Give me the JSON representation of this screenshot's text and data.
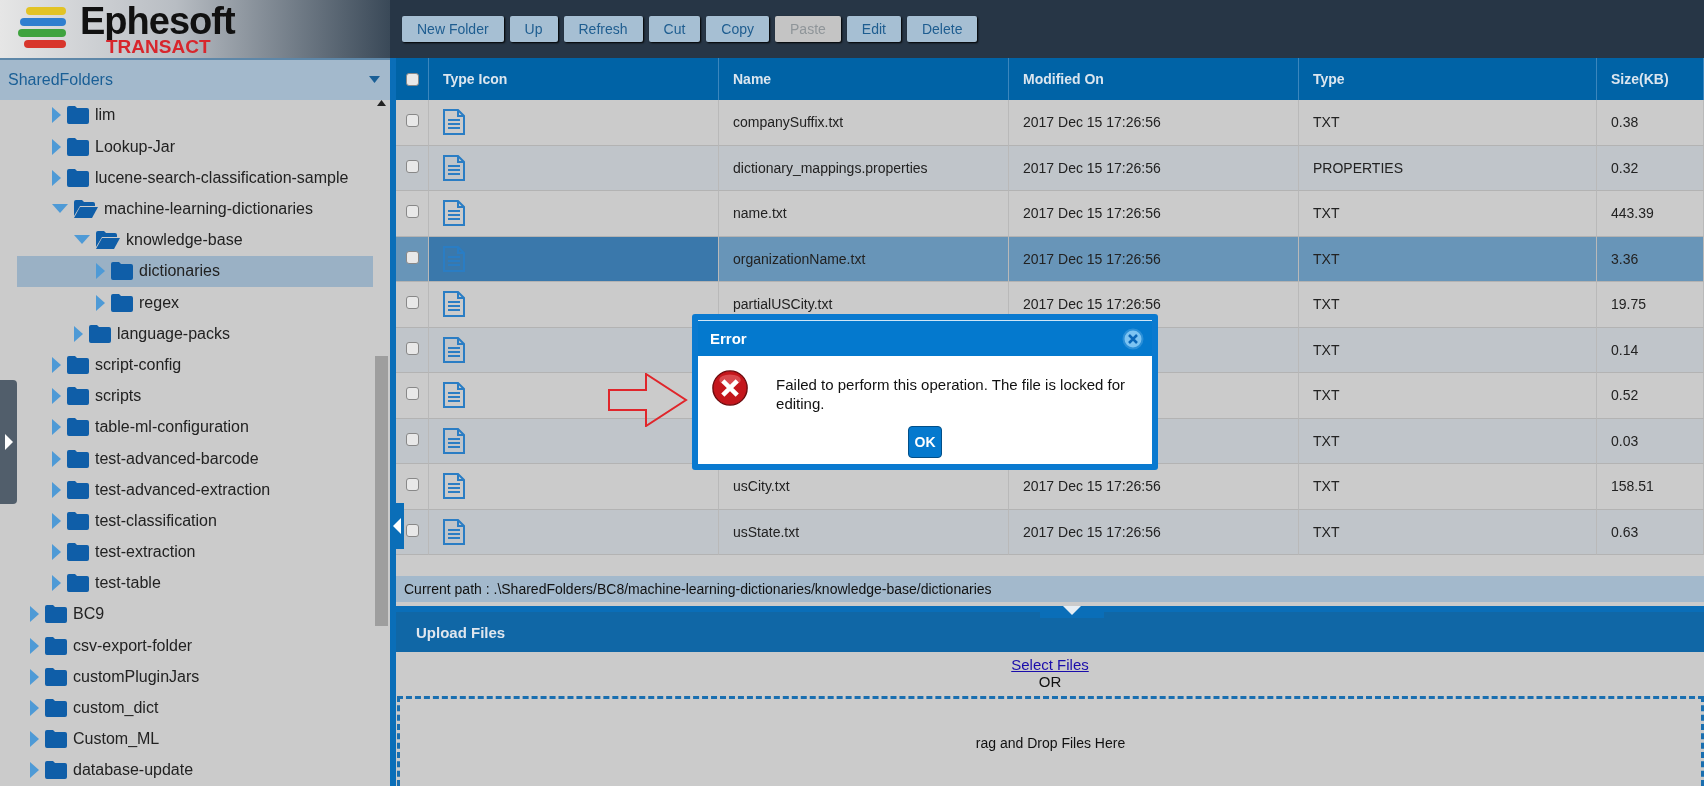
{
  "logo": {
    "name": "Ephesoft",
    "product": "TRANSACT"
  },
  "toolbar": [
    {
      "label": "New Folder",
      "disabled": false
    },
    {
      "label": "Up",
      "disabled": false
    },
    {
      "label": "Refresh",
      "disabled": false
    },
    {
      "label": "Cut",
      "disabled": false
    },
    {
      "label": "Copy",
      "disabled": false
    },
    {
      "label": "Paste",
      "disabled": true
    },
    {
      "label": "Edit",
      "disabled": false
    },
    {
      "label": "Delete",
      "disabled": false
    }
  ],
  "sidebar": {
    "root": "SharedFolders",
    "tree": [
      {
        "children": [
          {
            "label": "lim",
            "expanded": false,
            "selected": false
          },
          {
            "label": "Lookup-Jar",
            "expanded": false,
            "selected": false
          },
          {
            "label": "lucene-search-classification-sample",
            "expanded": false,
            "selected": false
          },
          {
            "label": "machine-learning-dictionaries",
            "expanded": true,
            "selected": false,
            "children": [
              {
                "label": "knowledge-base",
                "expanded": true,
                "selected": false,
                "children": [
                  {
                    "label": "dictionaries",
                    "expanded": false,
                    "selected": true
                  },
                  {
                    "label": "regex",
                    "expanded": false,
                    "selected": false
                  }
                ]
              },
              {
                "label": "language-packs",
                "expanded": false,
                "selected": false
              }
            ]
          },
          {
            "label": "script-config",
            "expanded": false,
            "selected": false
          },
          {
            "label": "scripts",
            "expanded": false,
            "selected": false
          },
          {
            "label": "table-ml-configuration",
            "expanded": false,
            "selected": false
          },
          {
            "label": "test-advanced-barcode",
            "expanded": false,
            "selected": false
          },
          {
            "label": "test-advanced-extraction",
            "expanded": false,
            "selected": false
          },
          {
            "label": "test-classification",
            "expanded": false,
            "selected": false
          },
          {
            "label": "test-extraction",
            "expanded": false,
            "selected": false
          },
          {
            "label": "test-table",
            "expanded": false,
            "selected": false
          }
        ]
      },
      {
        "label": "BC9",
        "expanded": false,
        "selected": false
      },
      {
        "label": "csv-export-folder",
        "expanded": false,
        "selected": false
      },
      {
        "label": "customPluginJars",
        "expanded": false,
        "selected": false
      },
      {
        "label": "custom_dict",
        "expanded": false,
        "selected": false
      },
      {
        "label": "Custom_ML",
        "expanded": false,
        "selected": false
      },
      {
        "label": "database-update",
        "expanded": false,
        "selected": false
      }
    ]
  },
  "table": {
    "header_checked": false,
    "columns": [
      "Type Icon",
      "Name",
      "Modified On",
      "Type",
      "Size(KB)"
    ],
    "rows": [
      {
        "checked": false,
        "selected": false,
        "name": "companySuffix.txt",
        "modified": "2017 Dec 15 17:26:56",
        "type": "TXT",
        "size": "0.38"
      },
      {
        "checked": false,
        "selected": false,
        "name": "dictionary_mappings.properties",
        "modified": "2017 Dec 15 17:26:56",
        "type": "PROPERTIES",
        "size": "0.32"
      },
      {
        "checked": false,
        "selected": false,
        "name": "name.txt",
        "modified": "2017 Dec 15 17:26:56",
        "type": "TXT",
        "size": "443.39"
      },
      {
        "checked": false,
        "selected": true,
        "name": "organizationName.txt",
        "modified": "2017 Dec 15 17:26:56",
        "type": "TXT",
        "size": "3.36"
      },
      {
        "checked": false,
        "selected": false,
        "name": "partialUSCity.txt",
        "modified": "2017 Dec 15 17:26:56",
        "type": "TXT",
        "size": "19.75"
      },
      {
        "checked": false,
        "selected": false,
        "type": "TXT",
        "size": "0.14"
      },
      {
        "checked": false,
        "selected": false,
        "type": "TXT",
        "size": "0.52"
      },
      {
        "checked": false,
        "selected": false,
        "type": "TXT",
        "size": "0.03"
      },
      {
        "checked": false,
        "selected": false,
        "name": "usCity.txt",
        "modified": "2017 Dec 15 17:26:56",
        "type": "TXT",
        "size": "158.51"
      },
      {
        "checked": false,
        "selected": false,
        "name": "usState.txt",
        "modified": "2017 Dec 15 17:26:56",
        "type": "TXT",
        "size": "0.63"
      }
    ]
  },
  "current_path": "Current path : .\\SharedFolders/BC8/machine-learning-dictionaries/knowledge-base/dictionaries",
  "upload": {
    "title": "Upload Files",
    "link": "Select Files",
    "or": "OR",
    "drop_hint": "rag and Drop Files Here"
  },
  "dialog": {
    "title": "Error",
    "message": "Failed to perform this operation. The file is locked for editing.",
    "button": "OK"
  }
}
